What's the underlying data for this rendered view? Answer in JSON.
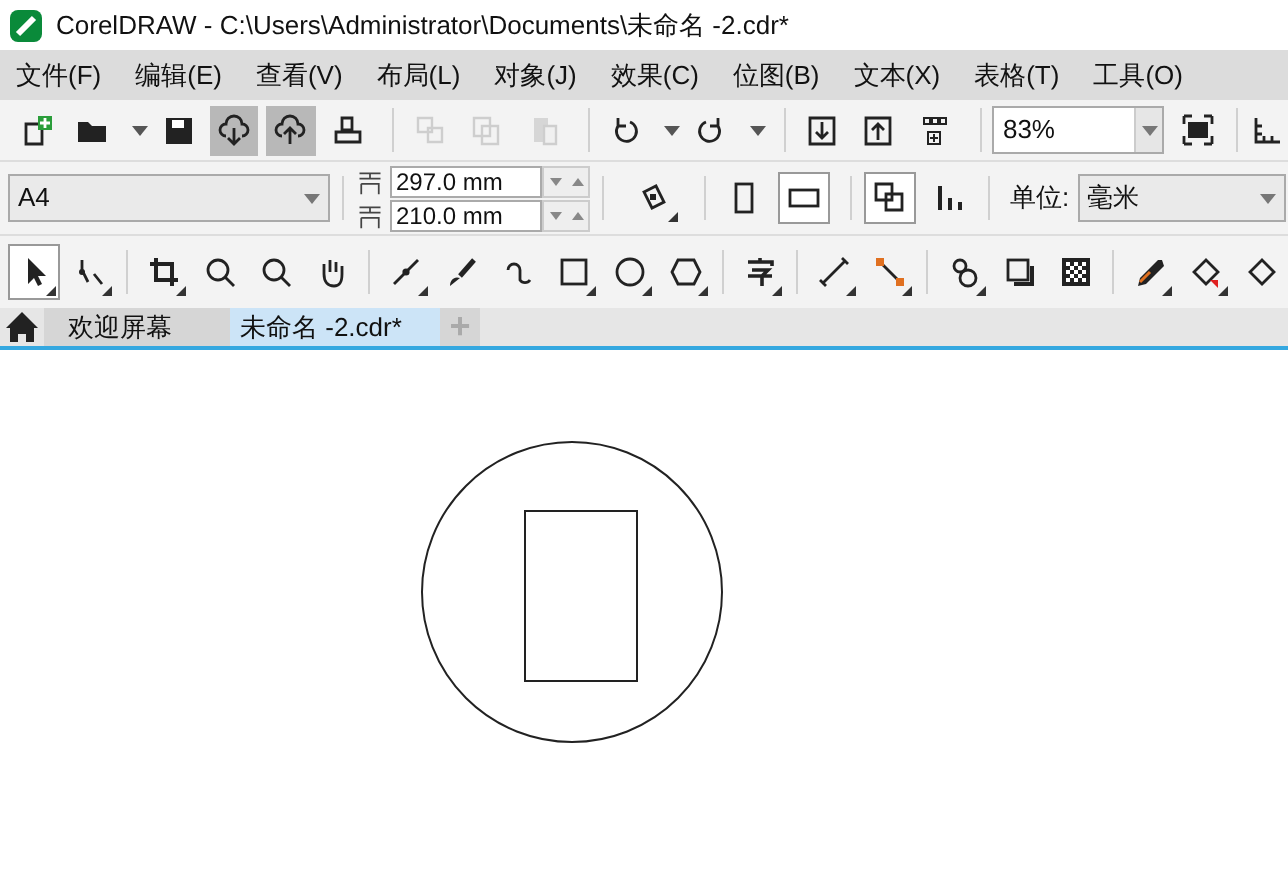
{
  "window": {
    "title": "CorelDRAW - C:\\Users\\Administrator\\Documents\\未命名 -2.cdr*"
  },
  "menu": [
    "文件(F)",
    "编辑(E)",
    "查看(V)",
    "布局(L)",
    "对象(J)",
    "效果(C)",
    "位图(B)",
    "文本(X)",
    "表格(T)",
    "工具(O)"
  ],
  "standard_toolbar": {
    "buttons": [
      {
        "pressed": false,
        "disabled": false
      },
      {
        "pressed": false,
        "disabled": false
      },
      {
        "pressed": false,
        "disabled": false
      },
      {
        "pressed": true,
        "disabled": false
      },
      {
        "pressed": true,
        "disabled": false
      },
      {
        "pressed": false,
        "disabled": false
      },
      {
        "pressed": false,
        "disabled": true
      },
      {
        "pressed": false,
        "disabled": true
      },
      {
        "pressed": false,
        "disabled": true
      },
      {
        "pressed": false,
        "disabled": false
      },
      {
        "pressed": false,
        "disabled": false
      },
      {
        "pressed": false,
        "disabled": false
      },
      {
        "pressed": false,
        "disabled": false
      },
      {
        "pressed": false,
        "disabled": false
      }
    ],
    "zoom": "83%"
  },
  "property_bar": {
    "page_size": "A4",
    "width": "297.0 mm",
    "height": "210.0 mm",
    "orientation": [
      {
        "selected": false
      },
      {
        "selected": true
      }
    ],
    "units_label": "单位:",
    "units": "毫米"
  },
  "toolbox": [
    {
      "selected": true
    },
    {
      "selected": false
    },
    {
      "selected": false
    },
    {
      "selected": false
    },
    {
      "selected": false
    },
    {
      "selected": false
    },
    {
      "selected": false
    },
    {
      "selected": false
    },
    {
      "selected": false
    },
    {
      "selected": false
    },
    {
      "selected": false
    },
    {
      "selected": false
    },
    {
      "selected": false
    },
    {
      "selected": false
    },
    {
      "selected": false
    },
    {
      "selected": false
    },
    {
      "selected": false
    },
    {
      "selected": false
    },
    {
      "selected": false
    },
    {
      "selected": false
    },
    {
      "selected": false
    }
  ],
  "tabs": [
    {
      "label": "欢迎屏幕",
      "selected": false
    },
    {
      "label": "未命名 -2.cdr*",
      "selected": true
    }
  ],
  "add_tab": "+"
}
